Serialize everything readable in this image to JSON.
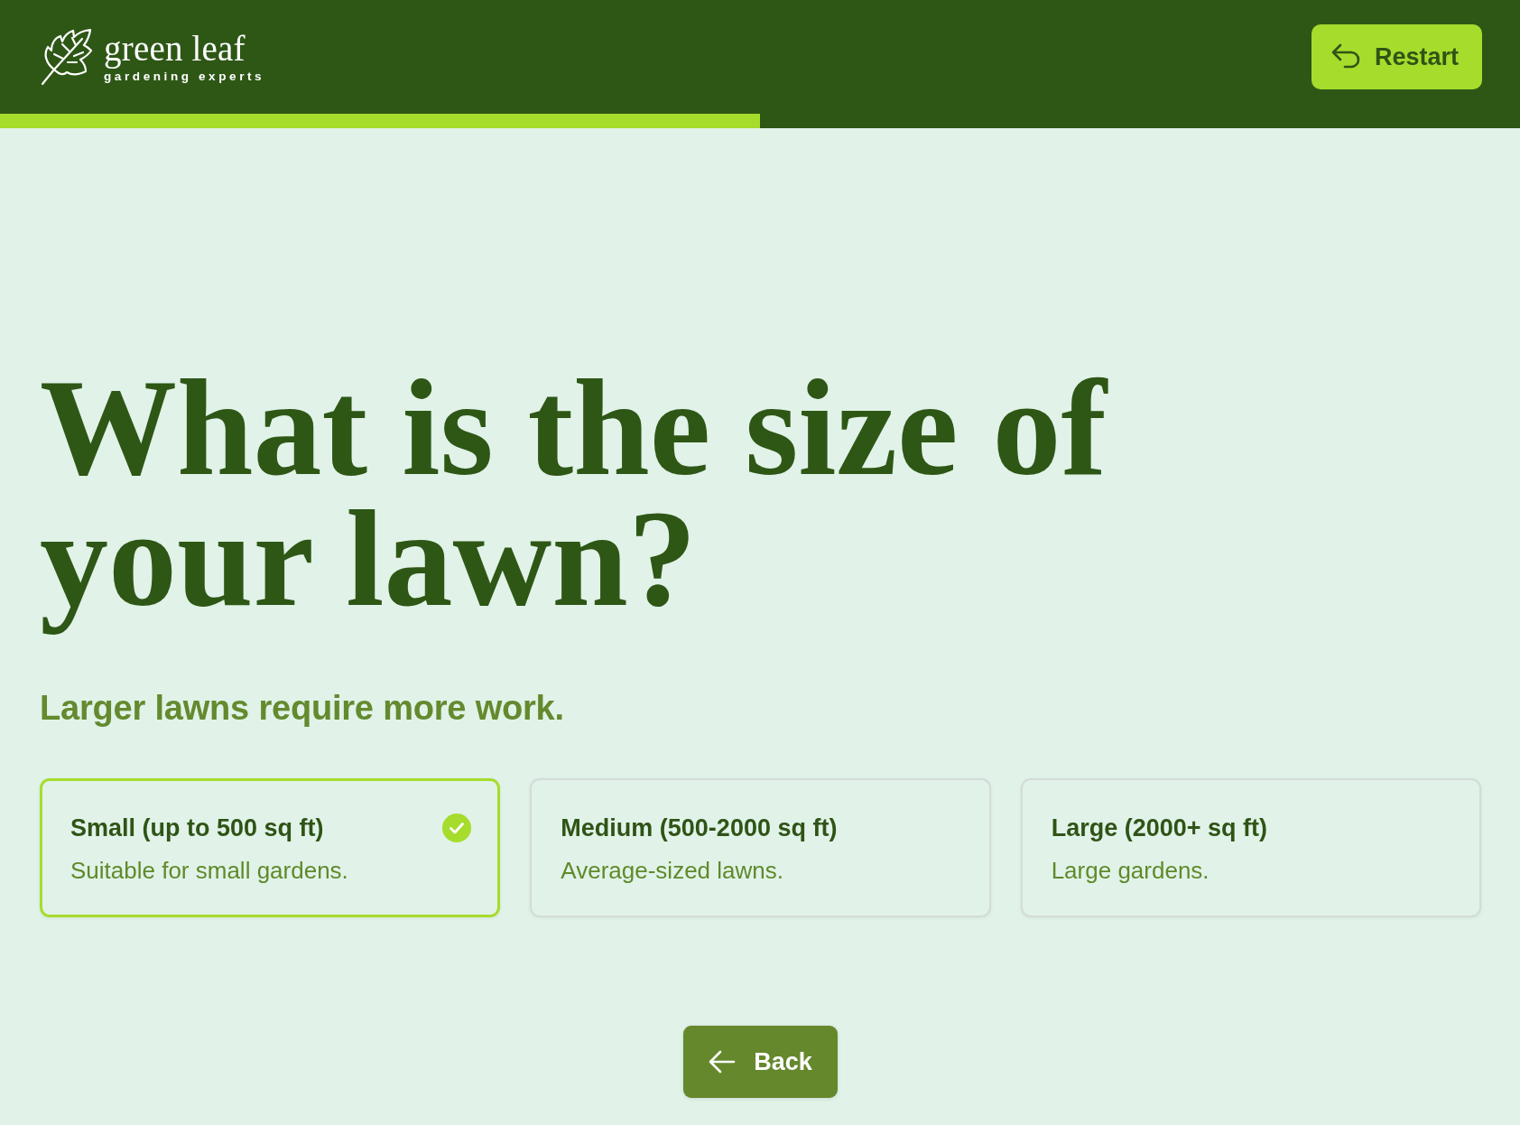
{
  "header": {
    "logo": {
      "name": "green leaf",
      "tagline": "gardening experts"
    },
    "restart_button": "Restart"
  },
  "progress": {
    "level": 0.5
  },
  "question": {
    "title": "What is the size of your lawn?",
    "subtitle": "Larger lawns require more work."
  },
  "options": [
    {
      "title": "Small (up to 500 sq ft)",
      "description": "Suitable for small gardens.",
      "selected": true
    },
    {
      "title": "Medium (500-2000 sq ft)",
      "description": "Average-sized lawns.",
      "selected": false
    },
    {
      "title": "Large (2000+ sq ft)",
      "description": "Large gardens.",
      "selected": false
    }
  ],
  "back_button": "Back"
}
